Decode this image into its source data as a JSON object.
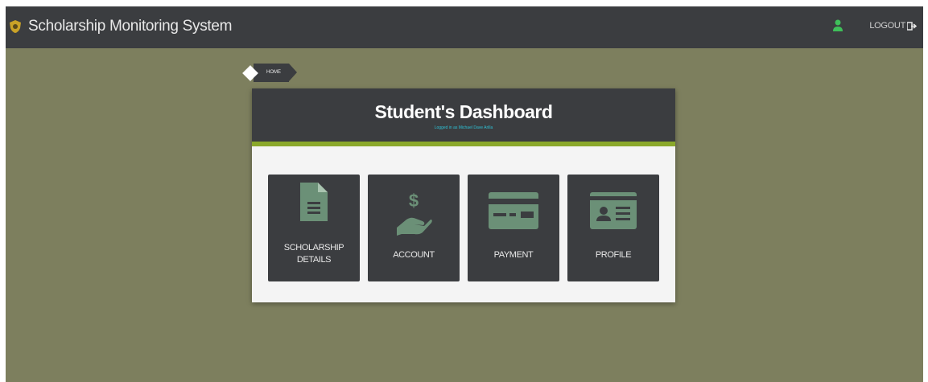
{
  "app": {
    "title": "Scholarship Monitoring System",
    "logout_label": "LOGOUT"
  },
  "breadcrumb": {
    "home": "HOME"
  },
  "dashboard": {
    "title": "Student's Dashboard",
    "subtitle": "Logged in as Michael Dave Arilla"
  },
  "tiles": [
    {
      "label_line1": "SCHOLARSHIP",
      "label_line2": "DETAILS",
      "icon": "document-icon"
    },
    {
      "label_line1": "ACCOUNT",
      "label_line2": "",
      "icon": "money-hand-icon"
    },
    {
      "label_line1": "PAYMENT",
      "label_line2": "",
      "icon": "credit-card-icon"
    },
    {
      "label_line1": "PROFILE",
      "label_line2": "",
      "icon": "id-card-icon"
    }
  ],
  "colors": {
    "background": "#7d7f5e",
    "dark": "#3b3d40",
    "accent_green": "#8aa82a",
    "icon_green": "#6b9077",
    "subtitle_blue": "#2ec0d4"
  }
}
